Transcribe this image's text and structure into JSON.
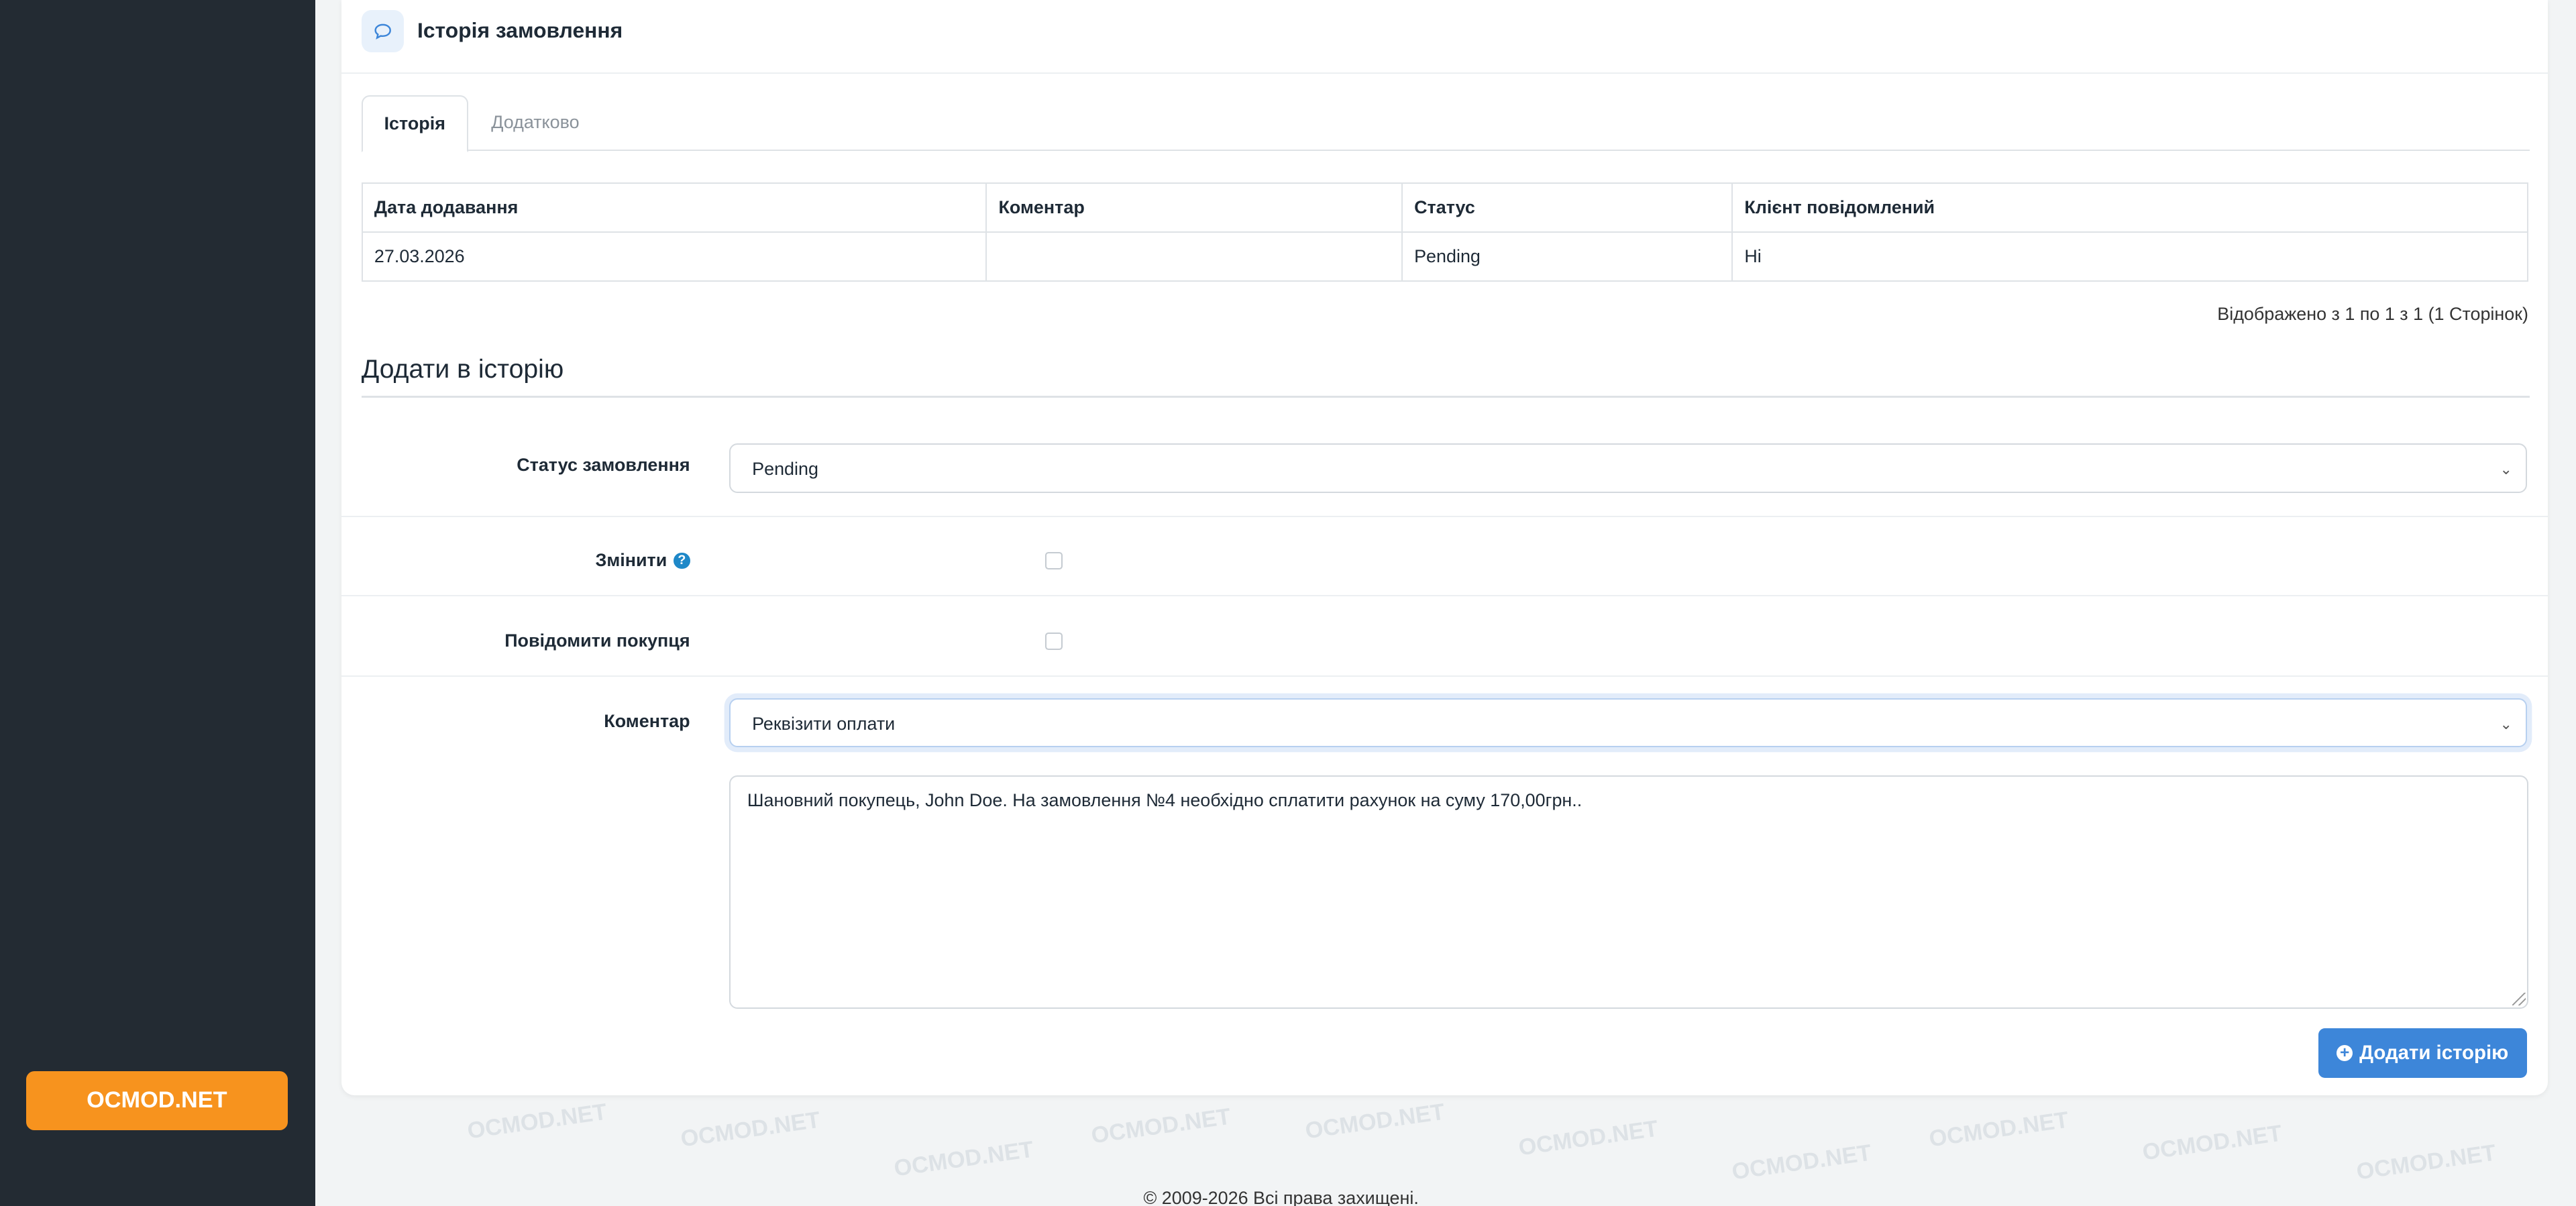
{
  "sidebar": {
    "brand_button": "OCMOD.NET"
  },
  "watermark": "OCMOD.NET",
  "card": {
    "title": "Історія замовлення",
    "tabs": [
      {
        "label": "Історія"
      },
      {
        "label": "Додатково"
      }
    ],
    "table": {
      "headers": [
        "Дата додавання",
        "Коментар",
        "Статус",
        "Клієнт повідомлений"
      ],
      "rows": [
        [
          "27.03.2026",
          "",
          "Pending",
          "Ні"
        ]
      ]
    },
    "pagination": "Відображено з 1 по 1 з 1 (1 Сторінок)"
  },
  "add_history": {
    "title": "Додати в історію",
    "order_status_label": "Статус замовлення",
    "order_status_value": "Pending",
    "override_label": "Змінити",
    "notify_label": "Повідомити покупця",
    "comment_label": "Коментар",
    "comment_template_value": "Реквізити оплати",
    "comment_text": "Шановний покупець, John Doe. На замовлення №4 необхідно сплатити рахунок на суму 170,00грн..",
    "submit_label": "Додати історію"
  },
  "footer": {
    "copyright": "© 2009-2026 Всі права захищені."
  },
  "colors": {
    "sidebar": "#232b33",
    "brand": "#f7931e",
    "primary": "#3d86d9",
    "help": "#1e88c8"
  }
}
